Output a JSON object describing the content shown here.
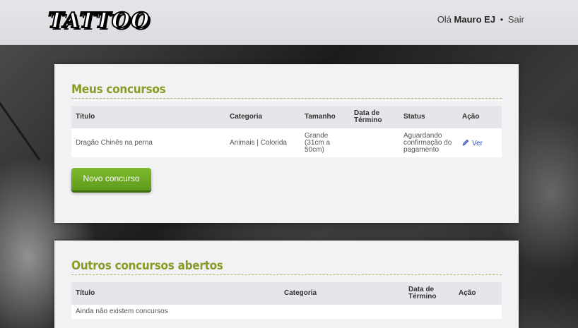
{
  "header": {
    "logo_text": "TATTOO",
    "greeting": "Olá",
    "user_name": "Mauro EJ",
    "separator": "•",
    "logout_label": "Sair"
  },
  "my_contests": {
    "title": "Meus concursos",
    "columns": [
      "Título",
      "Categoria",
      "Tamanho",
      "Data de Término",
      "Status",
      "Ação"
    ],
    "rows": [
      {
        "title": "Dragão Chinês na perna",
        "category": "Animais | Colorida",
        "size": "Grande (31cm a 50cm)",
        "end_date": "",
        "status": "Aguardando confirmação do pagamento",
        "action": "Ver"
      }
    ],
    "new_button": "Novo concurso"
  },
  "other_contests": {
    "title": "Outros concursos abertos",
    "columns": [
      "Título",
      "Categoria",
      "Data de Término",
      "Ação"
    ],
    "empty_message": "Ainda não existem concursos"
  },
  "colors": {
    "accent_title": "#8a9a26",
    "button_green": "#6aa822",
    "link_blue": "#3b4fb5"
  }
}
